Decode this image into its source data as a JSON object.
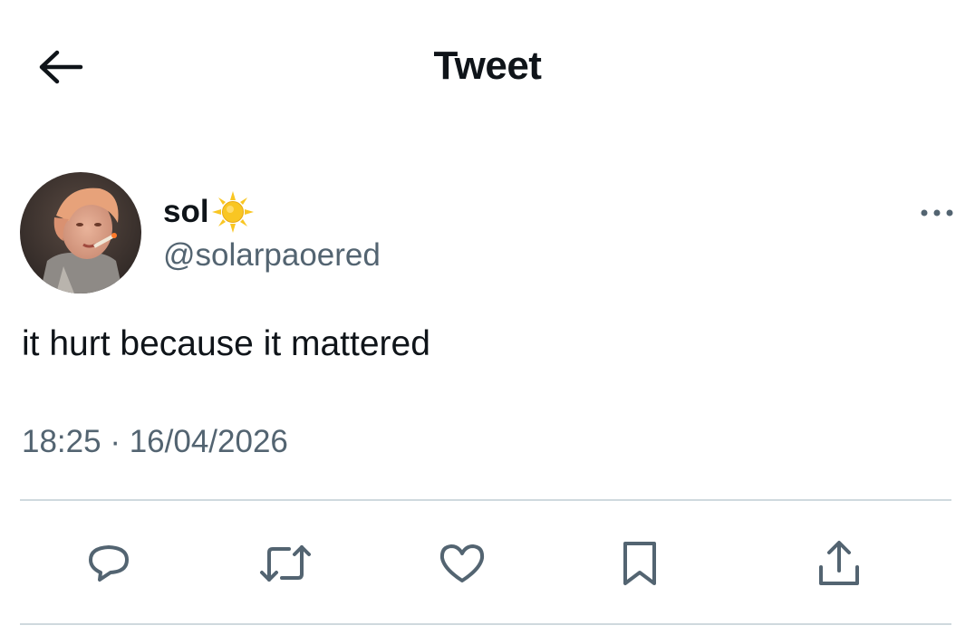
{
  "header": {
    "title": "Tweet",
    "back_icon": "arrow-left-icon"
  },
  "tweet": {
    "author": {
      "display_name": "sol",
      "name_emoji": "sun-emoji-icon",
      "handle": "@solarpaoered",
      "avatar": "profile-photo"
    },
    "text": "it hurt because it mattered",
    "time": "18:25",
    "separator": "·",
    "date": "16/04/2026",
    "more_icon": "more-dots-icon"
  },
  "actions": [
    {
      "name": "reply",
      "icon": "reply-icon"
    },
    {
      "name": "retweet",
      "icon": "retweet-icon"
    },
    {
      "name": "like",
      "icon": "heart-icon"
    },
    {
      "name": "bookmark",
      "icon": "bookmark-icon"
    },
    {
      "name": "share",
      "icon": "share-icon"
    }
  ],
  "colors": {
    "text_primary": "#0f1419",
    "text_secondary": "#536471",
    "divider": "#cfd9de",
    "sun_yellow": "#f9c623"
  }
}
